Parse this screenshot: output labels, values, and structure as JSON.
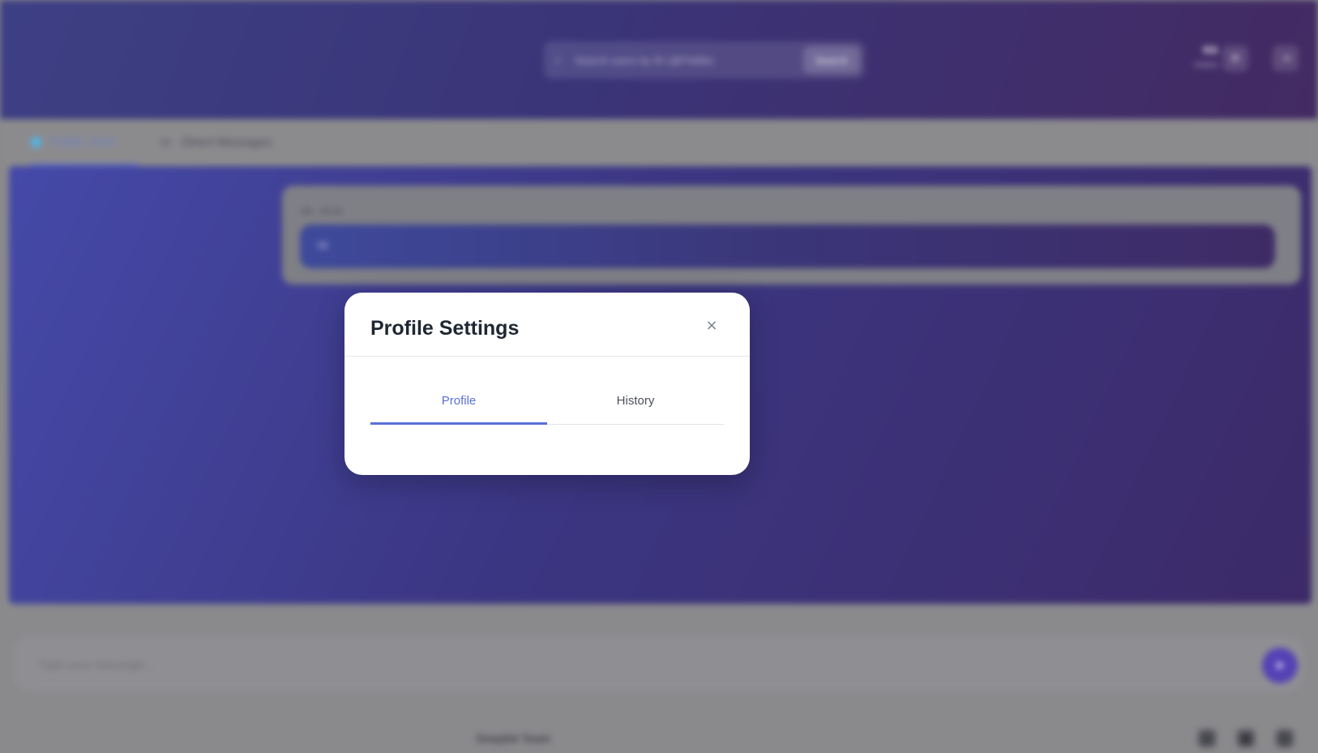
{
  "header": {
    "search_placeholder": "Search users by ID (@Fiddle)",
    "search_button": "Search",
    "user_name": "Kit",
    "user_status": "Online"
  },
  "tabs": [
    {
      "label": "Public Chat"
    },
    {
      "label": "Direct Messages"
    }
  ],
  "chat": {
    "message_meta": "Kit · 10:14",
    "message_text": "Hi"
  },
  "composer": {
    "placeholder": "Type your message..."
  },
  "footer": {
    "text": "Deepbit Team"
  },
  "modal": {
    "title": "Profile Settings",
    "close_glyph": "×",
    "tabs": [
      {
        "label": "Profile",
        "active": true
      },
      {
        "label": "History",
        "active": false
      }
    ]
  },
  "colors": {
    "accent": "#5a6fd8",
    "header_gradient_start": "#3d3f84",
    "header_gradient_end": "#432a62"
  }
}
